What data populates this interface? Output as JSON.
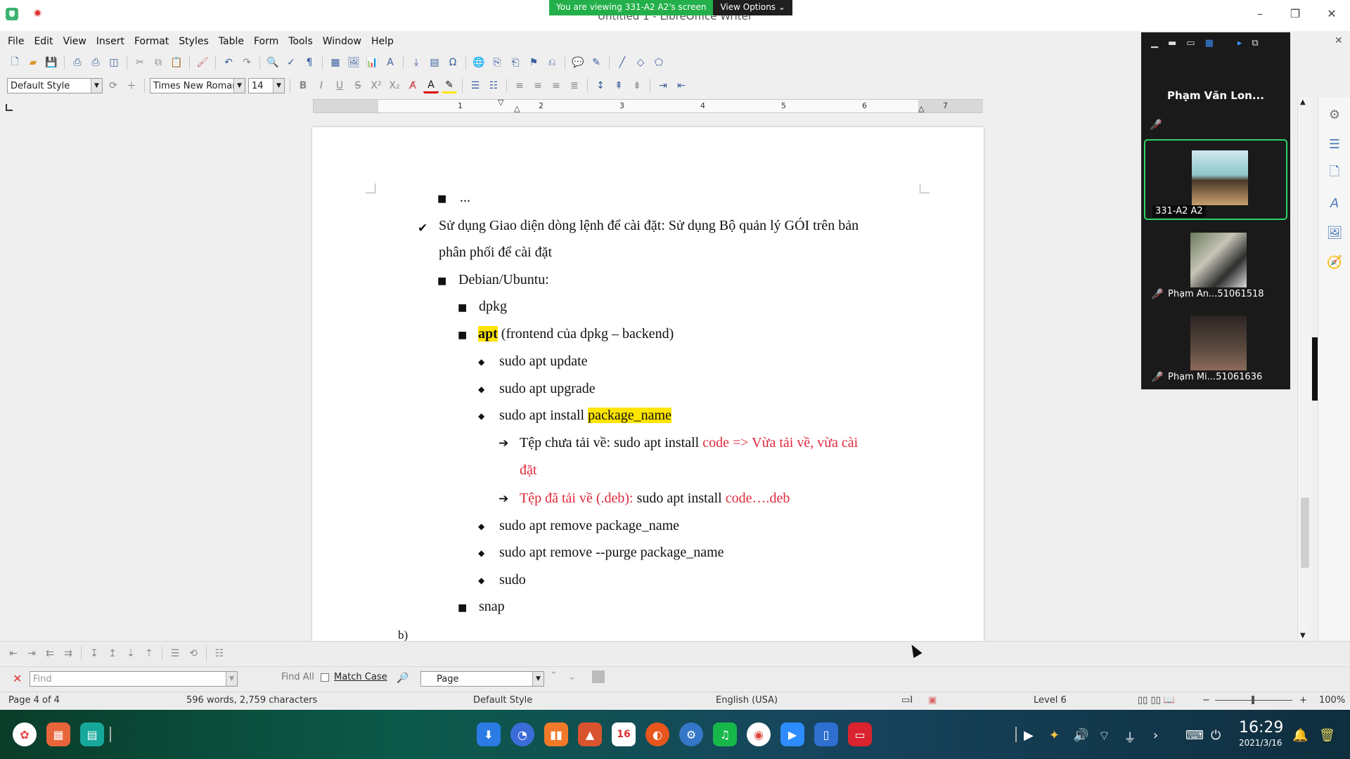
{
  "window": {
    "title": "Untitled 1 - LibreOffice Writer",
    "share_banner": "You are viewing 331-A2 A2's screen",
    "view_options": "View Options ⌄"
  },
  "menu": [
    "File",
    "Edit",
    "View",
    "Insert",
    "Format",
    "Styles",
    "Table",
    "Form",
    "Tools",
    "Window",
    "Help"
  ],
  "formatting": {
    "paragraph_style": "Default Style",
    "font_name": "Times New Roman",
    "font_size": "14"
  },
  "ruler": {
    "numbers": [
      "1",
      "2",
      "3",
      "4",
      "5",
      "6",
      "7"
    ]
  },
  "document": {
    "lines": [
      {
        "bullet": "■",
        "text": "..."
      },
      {
        "bullet": "✔",
        "text": "Sử dụng Giao diện dòng lệnh để cài đặt: Sử dụng Bộ quản lý GÓI trên bản"
      },
      {
        "bullet": "",
        "text": "phân phối để cài đặt"
      },
      {
        "bullet": "■",
        "text": "Debian/Ubuntu:"
      },
      {
        "bullet": "■",
        "text": "dpkg"
      },
      {
        "bullet": "■",
        "hl": "apt",
        "text": " (frontend của dpkg – backend)"
      },
      {
        "bullet": "◆",
        "text": "sudo apt update"
      },
      {
        "bullet": "◆",
        "text": "sudo apt upgrade"
      },
      {
        "bullet": "◆",
        "text": "sudo apt install ",
        "hl": "package_name"
      },
      {
        "bullet": "➔",
        "text": "Tệp chưa tải về: sudo apt install ",
        "red": "code => Vừa tải về, vừa cài"
      },
      {
        "bullet": "",
        "red": "đặt"
      },
      {
        "bullet": "➔",
        "red": "Tệp đã tải về (.deb):",
        "text": " sudo apt install ",
        "red2": "code….deb"
      },
      {
        "bullet": "◆",
        "text": "sudo apt remove package_name"
      },
      {
        "bullet": "◆",
        "text": "sudo apt remove --purge package_name"
      },
      {
        "bullet": "◆",
        "text": "sudo"
      },
      {
        "bullet": "■",
        "text": "snap"
      },
      {
        "bullet": "",
        "text": "b)"
      }
    ]
  },
  "meeting": {
    "presenter_name": "Phạm Văn Lon...",
    "participants": [
      {
        "label": "331-A2 A2"
      },
      {
        "label": "Phạm An...51061518"
      },
      {
        "label": "Phạm Mi...51061636"
      }
    ]
  },
  "find": {
    "placeholder": "Find",
    "find_all": "Find All",
    "match_case": "Match Case",
    "search_scope": "Page"
  },
  "status": {
    "page": "Page 4 of 4",
    "words": "596 words, 2,759 characters",
    "style": "Default Style",
    "language": "English (USA)",
    "level": "Level 6",
    "zoom": "100%"
  },
  "clock": {
    "time": "16:29",
    "date": "2021/3/16"
  },
  "calendar_day": "16"
}
